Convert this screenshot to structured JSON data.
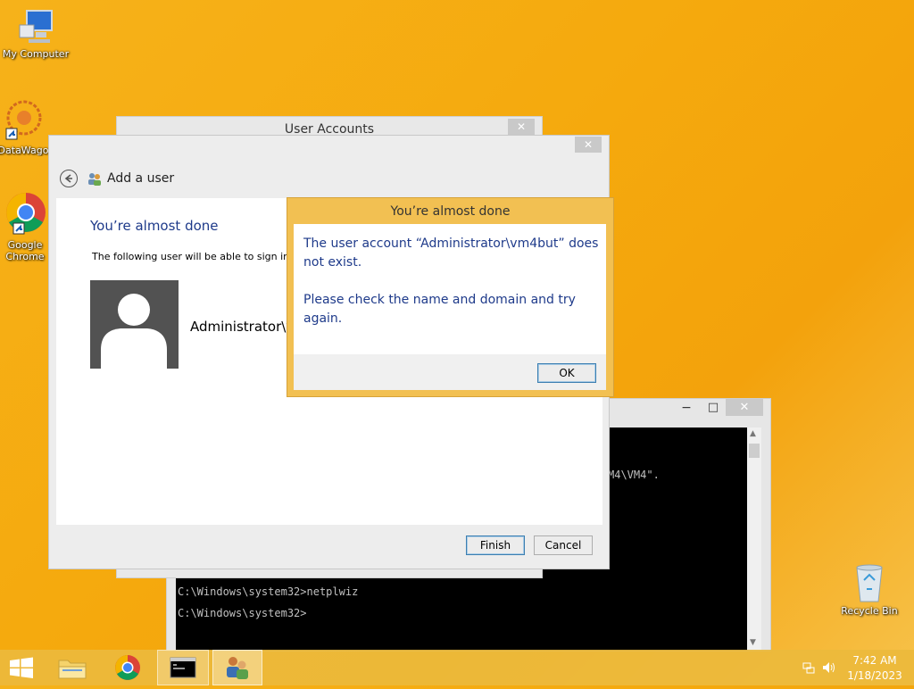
{
  "desktop": {
    "icons": [
      {
        "label": "My Computer",
        "icon": "computer-icon"
      },
      {
        "label": "DataWago",
        "icon": "datawago-icon"
      },
      {
        "label": "Google Chrome",
        "icon": "chrome-icon"
      },
      {
        "label": "Recycle Bin",
        "icon": "recycle-bin-icon"
      }
    ]
  },
  "user_accounts_window": {
    "title": "User Accounts",
    "close_glyph": "✕"
  },
  "add_user_window": {
    "nav_title": "Add a user",
    "heading": "You’re almost done",
    "description": "The following user will be able to sign in t",
    "username": "Administrator\\v",
    "finish_label": "Finish",
    "cancel_label": "Cancel",
    "close_glyph": "✕"
  },
  "message_dialog": {
    "title": "You’re almost done",
    "message_line1": "The user account “Administrator\\vm4but” does not exist.",
    "message_line2": "Please check the name and domain and try again.",
    "ok_label": "OK"
  },
  "cmd_window": {
    "partial_line": "M4\\VM4\".",
    "line1": "C:\\Windows\\system32>netplwiz",
    "line2": "C:\\Windows\\system32>",
    "minimize_glyph": "−",
    "maximize_glyph": "□",
    "close_glyph": "✕"
  },
  "taskbar": {
    "time": "7:42 AM",
    "date": "1/18/2023"
  }
}
